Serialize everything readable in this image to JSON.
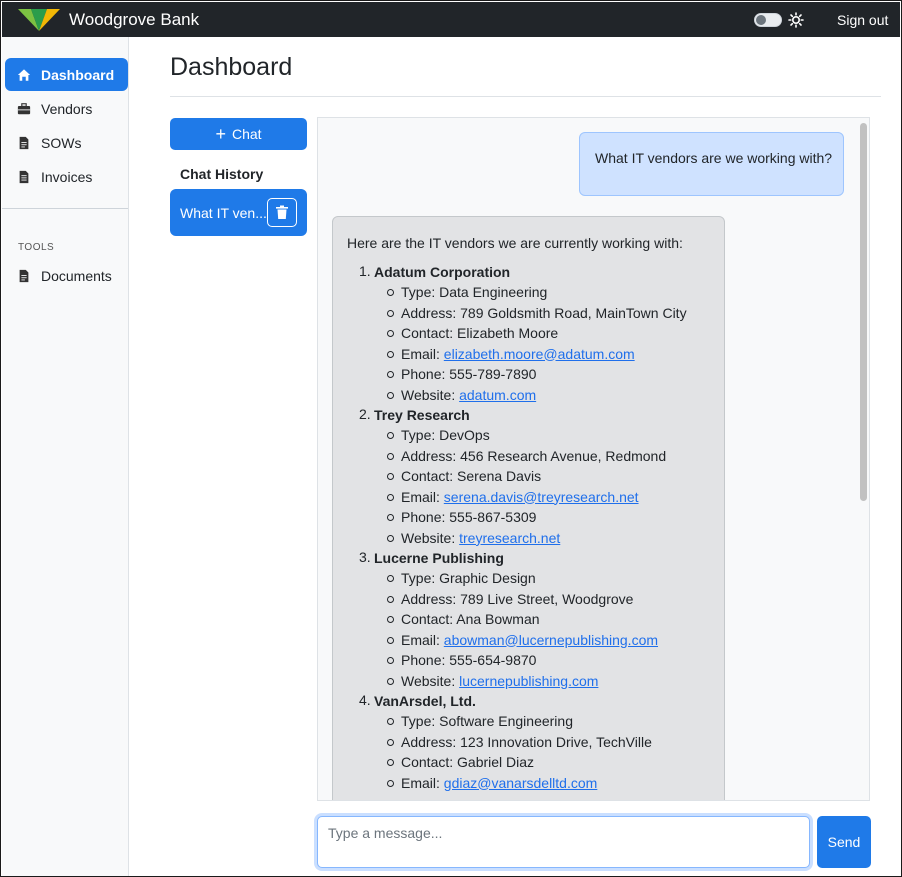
{
  "app": {
    "brand": "Woodgrove Bank",
    "accent": "#1f7ae8",
    "navbar_bg": "#212529"
  },
  "header": {
    "sign_out": "Sign out",
    "theme_toggle": "off"
  },
  "sidebar": {
    "items": [
      {
        "label": "Dashboard",
        "icon": "home-icon",
        "active": true
      },
      {
        "label": "Vendors",
        "icon": "briefcase-icon"
      },
      {
        "label": "SOWs",
        "icon": "document-icon"
      },
      {
        "label": "Invoices",
        "icon": "document-text-icon"
      }
    ],
    "tools_label": "TOOLS",
    "tools": [
      {
        "label": "Documents",
        "icon": "document-icon"
      }
    ]
  },
  "main": {
    "title": "Dashboard",
    "new_chat_label": "Chat",
    "history_label": "Chat History",
    "history": [
      {
        "label": "What IT ven..."
      }
    ]
  },
  "chat": {
    "user_message": "What IT vendors are we working with?",
    "bot_intro": "Here are the IT vendors we are currently working with:",
    "vendors": [
      {
        "num": "1.",
        "name": "Adatum Corporation",
        "type": "Type: Data Engineering",
        "address": "Address: 789 Goldsmith Road, MainTown City",
        "contact": "Contact: Elizabeth Moore",
        "email_prefix": "Email: ",
        "email": "elizabeth.moore@adatum.com",
        "phone": "Phone: 555-789-7890",
        "website_prefix": "Website: ",
        "website": "adatum.com"
      },
      {
        "num": "2.",
        "name": "Trey Research",
        "type": "Type: DevOps",
        "address": "Address: 456 Research Avenue, Redmond",
        "contact": "Contact: Serena Davis",
        "email_prefix": "Email: ",
        "email": "serena.davis@treyresearch.net",
        "phone": "Phone: 555-867-5309",
        "website_prefix": "Website: ",
        "website": "treyresearch.net"
      },
      {
        "num": "3.",
        "name": "Lucerne Publishing",
        "type": "Type: Graphic Design",
        "address": "Address: 789 Live Street, Woodgrove",
        "contact": "Contact: Ana Bowman",
        "email_prefix": "Email: ",
        "email": "abowman@lucernepublishing.com",
        "phone": "Phone: 555-654-9870",
        "website_prefix": "Website: ",
        "website": "lucernepublishing.com"
      },
      {
        "num": "4.",
        "name": "VanArsdel, Ltd.",
        "type": "Type: Software Engineering",
        "address": "Address: 123 Innovation Drive, TechVille",
        "contact": "Contact: Gabriel Diaz",
        "email_prefix": "Email: ",
        "email": "gdiaz@vanarsdelltd.com"
      }
    ]
  },
  "composer": {
    "placeholder": "Type a message...",
    "value": "",
    "send_label": "Send"
  }
}
